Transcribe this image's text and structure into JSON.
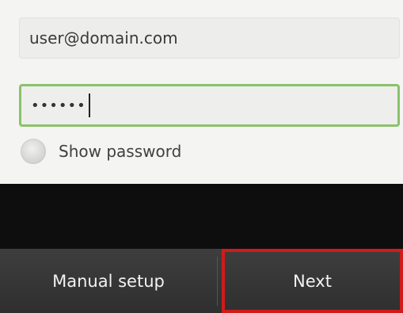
{
  "form": {
    "email_value": "user@domain.com",
    "password_mask": "••••••",
    "show_password_label": "Show password",
    "show_password_checked": false
  },
  "buttons": {
    "manual_setup_label": "Manual setup",
    "next_label": "Next"
  },
  "colors": {
    "focus_border": "#8bc26a",
    "highlight_border": "#d11a1a",
    "button_bar": "#3a3a3a"
  }
}
